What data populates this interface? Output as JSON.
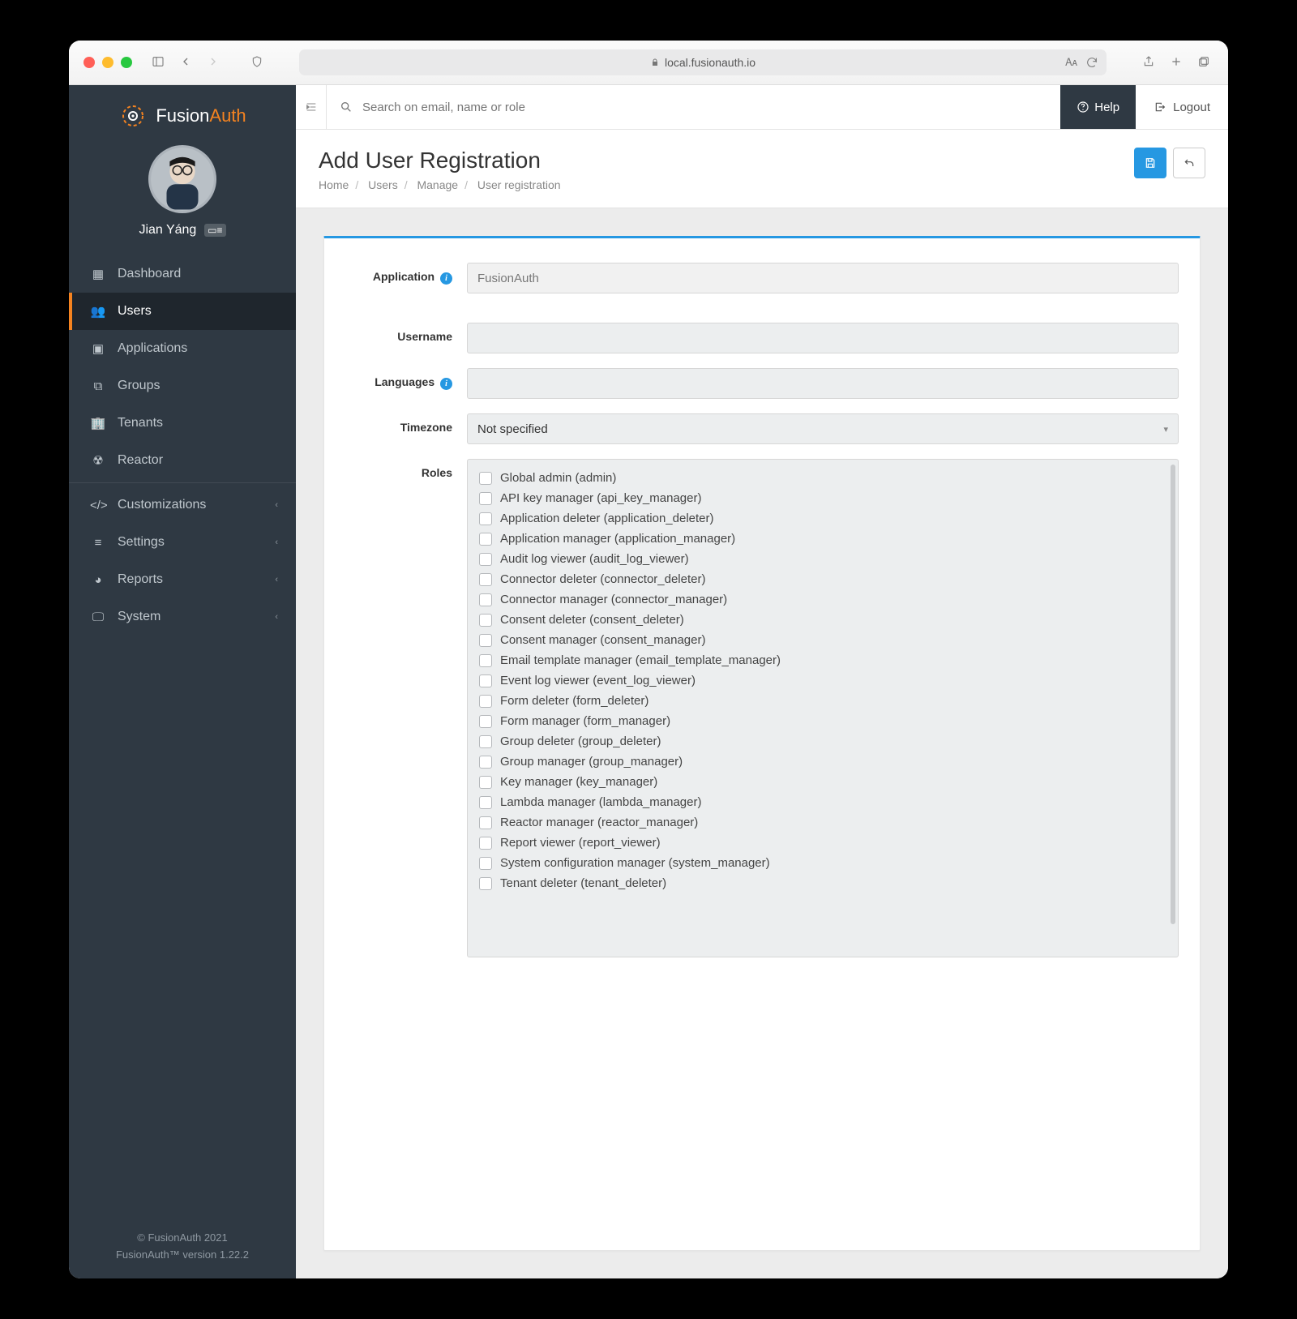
{
  "browser": {
    "url": "local.fusionauth.io"
  },
  "brand": {
    "name_a": "Fusion",
    "name_b": "Auth"
  },
  "user": {
    "name": "Jian Yáng"
  },
  "sidebar": {
    "items": [
      {
        "label": "Dashboard"
      },
      {
        "label": "Users"
      },
      {
        "label": "Applications"
      },
      {
        "label": "Groups"
      },
      {
        "label": "Tenants"
      },
      {
        "label": "Reactor"
      }
    ],
    "groups": [
      {
        "label": "Customizations"
      },
      {
        "label": "Settings"
      },
      {
        "label": "Reports"
      },
      {
        "label": "System"
      }
    ]
  },
  "footer": {
    "line1": "© FusionAuth 2021",
    "line2": "FusionAuth™ version 1.22.2"
  },
  "topbar": {
    "search_placeholder": "Search on email, name or role",
    "help": "Help",
    "logout": "Logout"
  },
  "page": {
    "title": "Add User Registration",
    "breadcrumbs": [
      "Home",
      "Users",
      "Manage",
      "User registration"
    ]
  },
  "form": {
    "labels": {
      "application": "Application",
      "username": "Username",
      "languages": "Languages",
      "timezone": "Timezone",
      "roles": "Roles"
    },
    "application_value": "FusionAuth",
    "timezone_value": "Not specified",
    "roles": [
      "Global admin (admin)",
      "API key manager (api_key_manager)",
      "Application deleter (application_deleter)",
      "Application manager (application_manager)",
      "Audit log viewer (audit_log_viewer)",
      "Connector deleter (connector_deleter)",
      "Connector manager (connector_manager)",
      "Consent deleter (consent_deleter)",
      "Consent manager (consent_manager)",
      "Email template manager (email_template_manager)",
      "Event log viewer (event_log_viewer)",
      "Form deleter (form_deleter)",
      "Form manager (form_manager)",
      "Group deleter (group_deleter)",
      "Group manager (group_manager)",
      "Key manager (key_manager)",
      "Lambda manager (lambda_manager)",
      "Reactor manager (reactor_manager)",
      "Report viewer (report_viewer)",
      "System configuration manager (system_manager)",
      "Tenant deleter (tenant_deleter)"
    ]
  }
}
